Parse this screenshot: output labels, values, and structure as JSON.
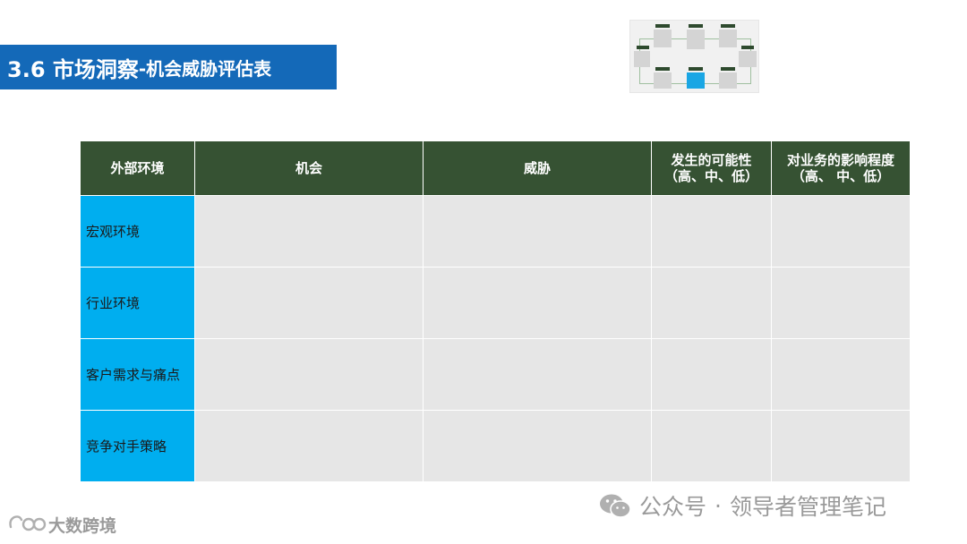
{
  "slide": {
    "title_main": "3.6 市场洞察",
    "title_sub": "-机会威胁评估表"
  },
  "table": {
    "headers": [
      "外部环境",
      "机会",
      "威胁",
      "发生的可能性（高、中、低）",
      "对业务的影响程度（高、 中、低）"
    ],
    "rows": [
      {
        "label": "宏观环境",
        "cells": [
          "",
          "",
          "",
          ""
        ]
      },
      {
        "label": "行业环境",
        "cells": [
          "",
          "",
          "",
          ""
        ]
      },
      {
        "label": "客户需求与痛点",
        "cells": [
          "",
          "",
          "",
          ""
        ]
      },
      {
        "label": "竞争对手策略",
        "cells": [
          "",
          "",
          "",
          ""
        ]
      }
    ]
  },
  "watermarks": {
    "wechat_text": "公众号",
    "separator": "·",
    "account_name": "领导者管理笔记",
    "brand_text": "大数跨境",
    "wechat_icon": "wechat-icon",
    "brand_icon": "brand-logo-icon"
  }
}
